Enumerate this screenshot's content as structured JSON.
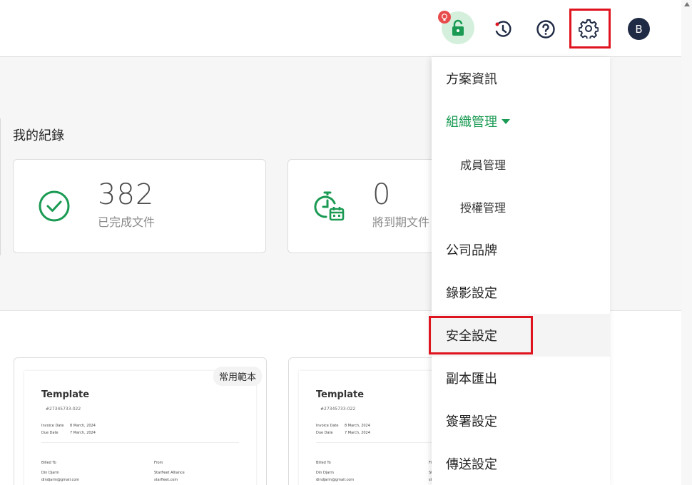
{
  "header": {
    "avatar_initial": "B",
    "icons": [
      "lock-icon",
      "history-icon",
      "help-icon",
      "gear-icon"
    ]
  },
  "summary": {
    "section_title": "我的紀錄",
    "stats": [
      {
        "value": "382",
        "label": "已完成文件",
        "icon": "check-circle-icon"
      },
      {
        "value": "0",
        "label": "將到期文件",
        "icon": "timer-calendar-icon"
      }
    ]
  },
  "templates": {
    "favorite_tag": "常用範本",
    "cards": [
      {
        "title": "Template",
        "number": "#27345733-022",
        "invoice_date_label": "Invoice Date",
        "invoice_date": "8 March, 2024",
        "due_date_label": "Due Date",
        "due_date": "7 March, 2024",
        "billed_to_label": "Billed To",
        "billed_name": "Din Djarin",
        "billed_email": "dindjarin@gmail.com",
        "from_label": "From",
        "from_name": "Starfleet Alliance",
        "from_site": "starfleet.com"
      },
      {
        "title": "Template",
        "number": "#27345733-022",
        "invoice_date_label": "Invoice Date",
        "invoice_date": "8 March, 2024",
        "due_date_label": "Due Date",
        "due_date": "7 March, 2024",
        "billed_to_label": "Billed To",
        "billed_name": "Din Djarin",
        "billed_email": "dindjarin@gmail.com",
        "from_label": "Fr",
        "from_name": "St",
        "from_site": "st"
      }
    ]
  },
  "menu": {
    "items": [
      {
        "label": "方案資訊"
      },
      {
        "label": "組織管理"
      },
      {
        "label": "成員管理"
      },
      {
        "label": "授權管理"
      },
      {
        "label": "公司品牌"
      },
      {
        "label": "錄影設定"
      },
      {
        "label": "安全設定"
      },
      {
        "label": "副本匯出"
      },
      {
        "label": "簽署設定"
      },
      {
        "label": "傳送設定"
      }
    ]
  },
  "colors": {
    "accent_green": "#1a9a53",
    "highlight_red": "#e0141e",
    "avatar_bg": "#1f2a44",
    "badge_red": "#e84c4c"
  }
}
